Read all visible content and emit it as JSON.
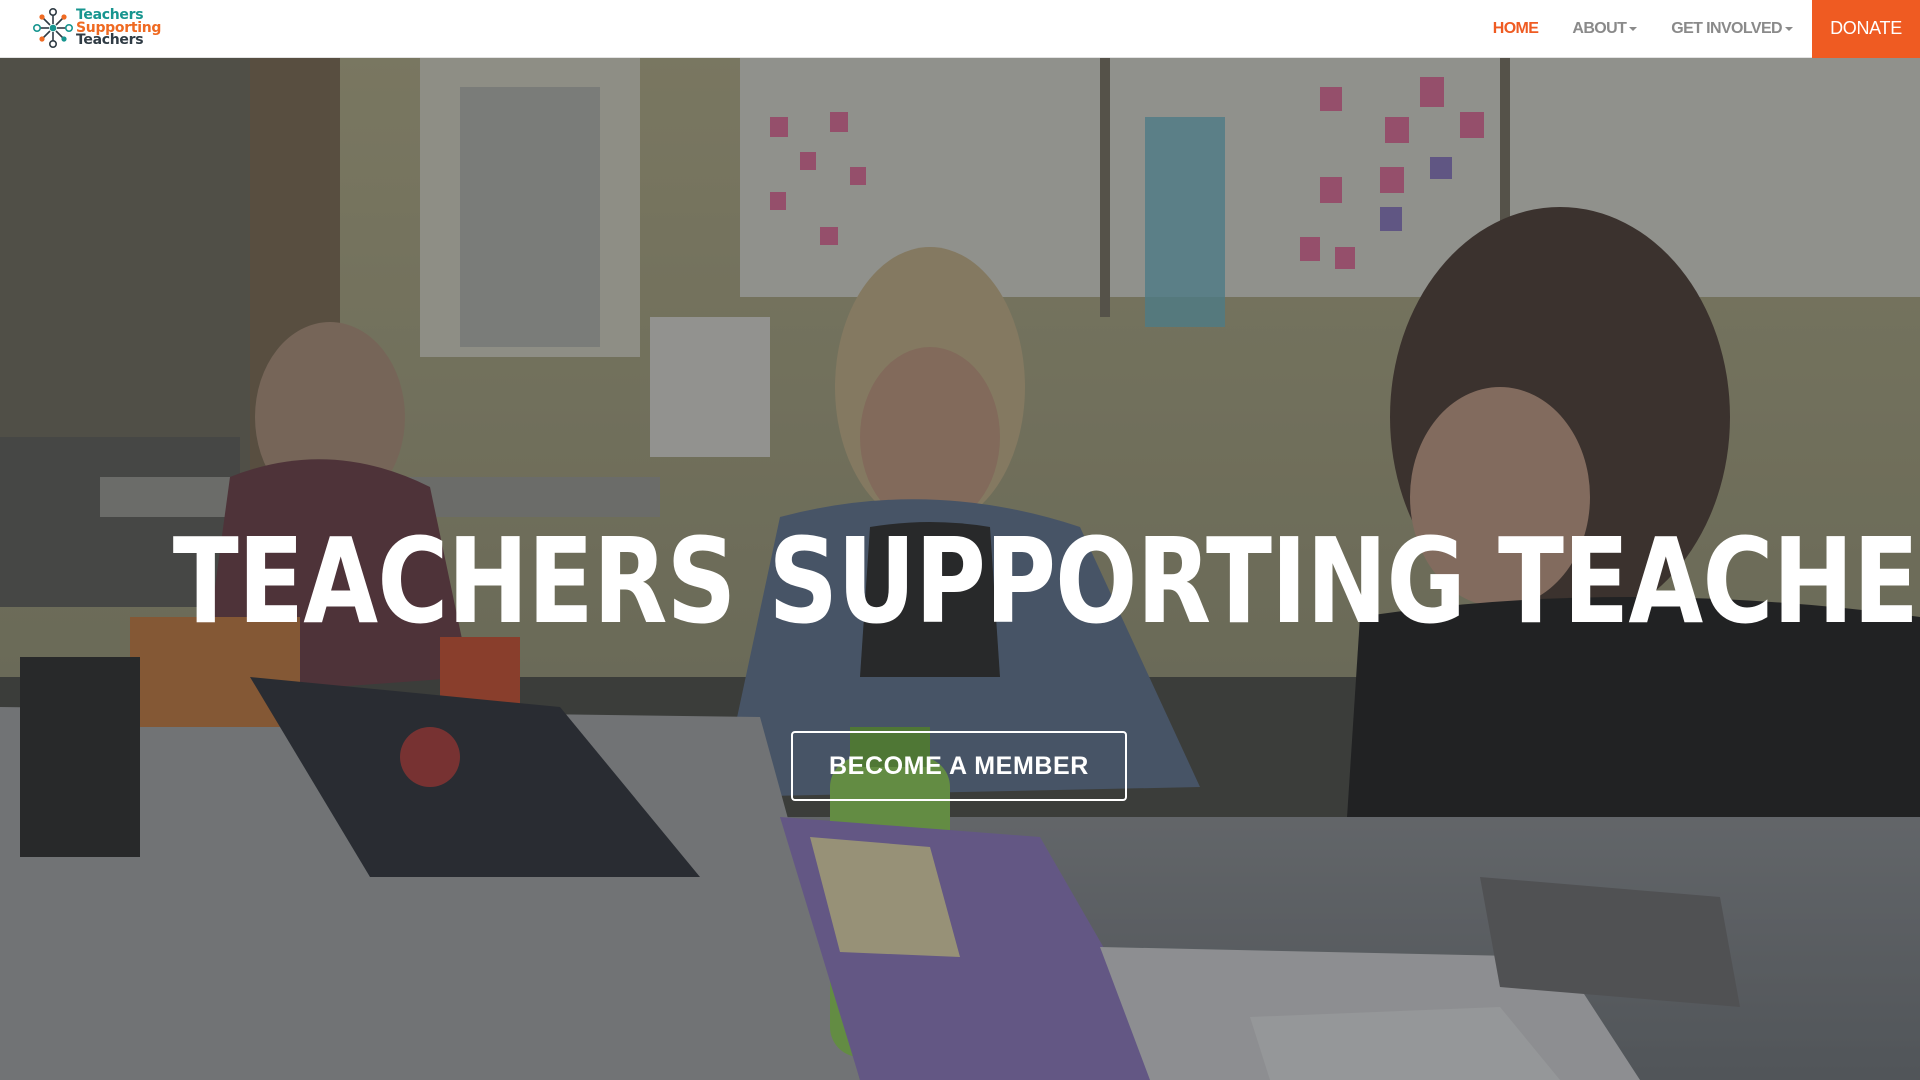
{
  "brand": {
    "line1": "Teachers",
    "line2": "Supporting",
    "line3": "Teachers",
    "colors": {
      "teal": "#17958f",
      "orange": "#ef6a22",
      "dark": "#2f3b44"
    }
  },
  "nav": {
    "items": [
      {
        "label": "HOME",
        "active": true
      },
      {
        "label": "ABOUT",
        "dropdown": true
      },
      {
        "label": "GET INVOLVED",
        "dropdown": true
      }
    ],
    "donate_label": "DONATE",
    "accent_color": "#ef5b22"
  },
  "hero": {
    "title": "TEACHERS SUPPORTING TEACHERS",
    "cta_label": "BECOME A MEMBER",
    "photo_description_icon": "classroom-photo"
  }
}
